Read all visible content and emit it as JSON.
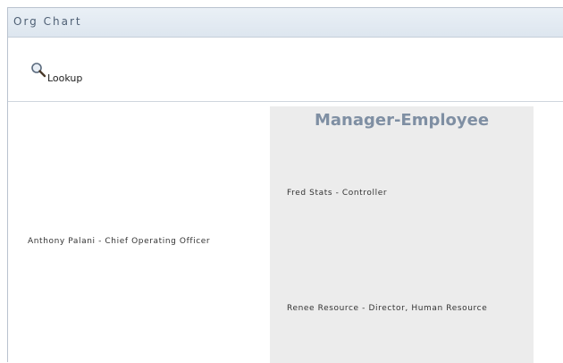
{
  "header": {
    "title": "Org Chart"
  },
  "toolbar": {
    "lookup_label": "Lookup",
    "lookup_icon": "magnifier-icon"
  },
  "org": {
    "panel_title": "Manager-Employee",
    "manager": "Anthony Palani - Chief Operating Officer",
    "employees": [
      "Fred Stats - Controller",
      "Renee Resource - Director, Human Resource"
    ]
  },
  "colors": {
    "header_bg": "#dde6ef",
    "panel_bg": "#ececec",
    "panel_title": "#7f8fa3"
  }
}
